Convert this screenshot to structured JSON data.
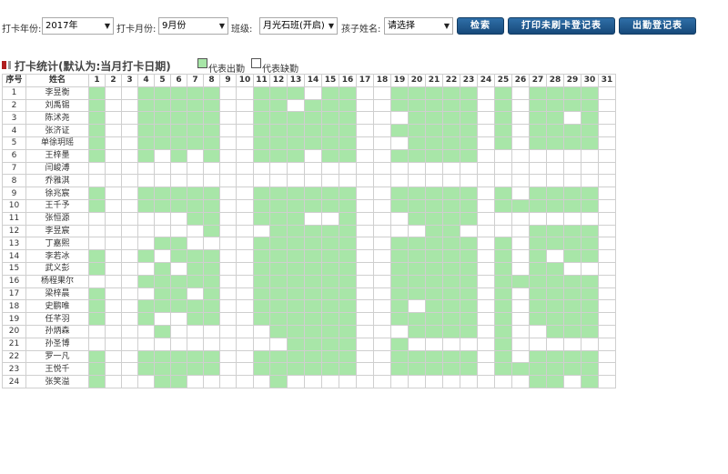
{
  "filters": {
    "year_label": "打卡年份:",
    "year_value": "2017年",
    "month_label": "打卡月份:",
    "month_value": "9月份",
    "class_label": "班级:",
    "class_value": "月光石班(开启)",
    "child_label": "孩子姓名:",
    "child_value": "请选择"
  },
  "buttons": {
    "search": "检索",
    "print_unswiped": "打印未刷卡登记表",
    "attendance": "出勤登记表"
  },
  "section": {
    "title": "打卡统计(默认为:当月打卡日期)",
    "legend_present": "代表出勤",
    "legend_absent": "代表缺勤"
  },
  "colors": {
    "present": "#a8e6a8",
    "absent": "#ffffff",
    "button": "#1f5a90"
  },
  "table": {
    "header_index": "序号",
    "header_name": "姓名",
    "days": [
      "1",
      "2",
      "3",
      "4",
      "5",
      "6",
      "7",
      "8",
      "9",
      "10",
      "11",
      "12",
      "13",
      "14",
      "15",
      "16",
      "17",
      "18",
      "19",
      "20",
      "21",
      "22",
      "23",
      "24",
      "25",
      "26",
      "27",
      "28",
      "29",
      "30",
      "31"
    ],
    "rows": [
      {
        "index": "1",
        "name": "李昱衡",
        "attendance": "1001111100111011001111101011110"
      },
      {
        "index": "2",
        "name": "刘禹锡",
        "attendance": "1001111100110111001111101011110"
      },
      {
        "index": "3",
        "name": "陈沭尧",
        "attendance": "1001111100111111000111101011010"
      },
      {
        "index": "4",
        "name": "张济证",
        "attendance": "1001111100111111001111101011110"
      },
      {
        "index": "5",
        "name": "单徐玥瑶",
        "attendance": "1001111100111111000111101011110"
      },
      {
        "index": "6",
        "name": "王梓墨",
        "attendance": "1001010100111011001111100000000"
      },
      {
        "index": "7",
        "name": "闫峻溥",
        "attendance": "0000000000000000000000000000000"
      },
      {
        "index": "8",
        "name": "乔雅淇",
        "attendance": "0000000000000000000000000000000"
      },
      {
        "index": "9",
        "name": "徐兆宸",
        "attendance": "1001111100111111001111101011110"
      },
      {
        "index": "10",
        "name": "王千予",
        "attendance": "1001111100111111001111101111110"
      },
      {
        "index": "11",
        "name": "张恒源",
        "attendance": "0000001100111001000111100000000"
      },
      {
        "index": "12",
        "name": "李昱宸",
        "attendance": "0000000100011111000011000011110"
      },
      {
        "index": "13",
        "name": "丁嘉熙",
        "attendance": "0000110000111111001111101011110"
      },
      {
        "index": "14",
        "name": "李若冰",
        "attendance": "1001011100111111001111101010110"
      },
      {
        "index": "15",
        "name": "武义彭",
        "attendance": "1000101100111111001111101011000"
      },
      {
        "index": "16",
        "name": "杨程果尔",
        "attendance": "0001111100111111001111101111110"
      },
      {
        "index": "17",
        "name": "梁梓晨",
        "attendance": "1000110100111111001111101011110"
      },
      {
        "index": "18",
        "name": "史鹏唯",
        "attendance": "1001111100111111001011101011110"
      },
      {
        "index": "19",
        "name": "任芊羽",
        "attendance": "1001001100111111001111101011110"
      },
      {
        "index": "20",
        "name": "孙炳森",
        "attendance": "0000100000011111000111101001110"
      },
      {
        "index": "21",
        "name": "孙圣博",
        "attendance": "0000000000001111001000001000000"
      },
      {
        "index": "22",
        "name": "罗一凡",
        "attendance": "1001111100111111001111101011110"
      },
      {
        "index": "23",
        "name": "王悦千",
        "attendance": "1001111100111111001111101111110"
      },
      {
        "index": "24",
        "name": "张笑溢",
        "attendance": "1000110000010000000000000011010"
      }
    ]
  }
}
